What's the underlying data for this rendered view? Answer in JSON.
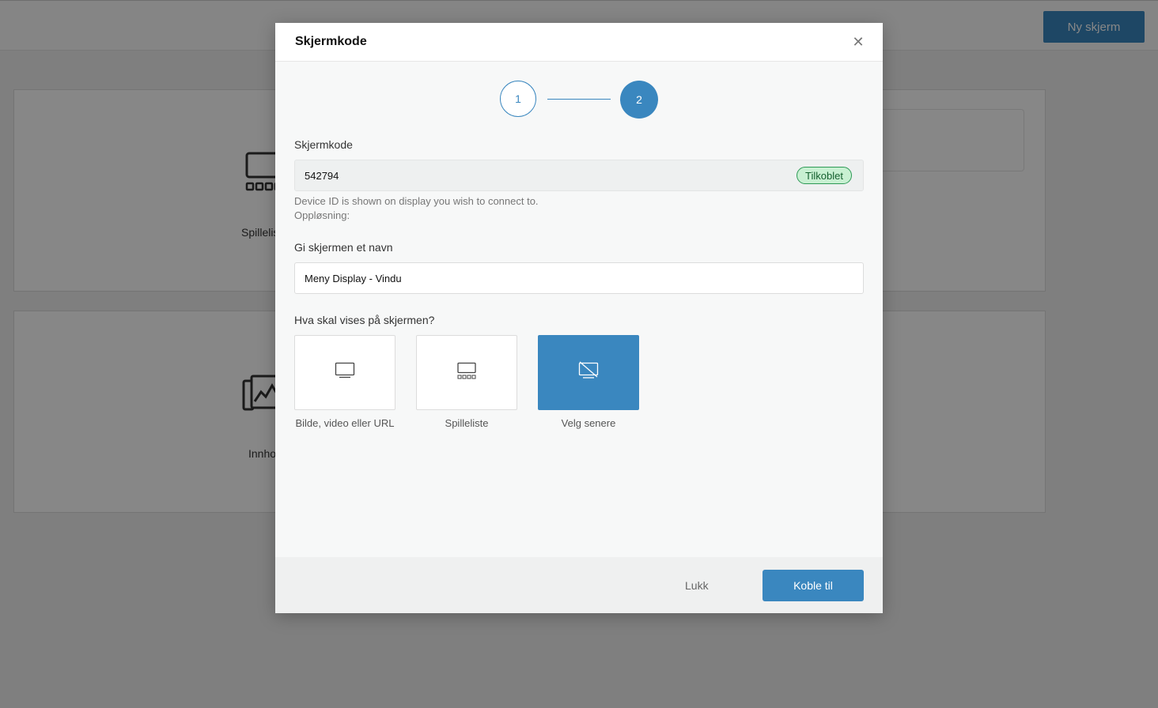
{
  "background": {
    "new_screen_button": "Ny skjerm",
    "cards": [
      {
        "label": "Spilleliste",
        "icon": "playlist-monitor-icon"
      },
      {
        "label": "Innhold",
        "icon": "media-gallery-icon"
      }
    ]
  },
  "modal": {
    "title": "Skjermkode",
    "close_icon": "close-icon",
    "steps": [
      "1",
      "2"
    ],
    "active_step": 2,
    "screen_code": {
      "label": "Skjermkode",
      "value": "542794",
      "status": "Tilkoblet",
      "help": "Device ID is shown on display you wish to connect to.",
      "resolution_label": "Oppløsning:"
    },
    "name_field": {
      "label": "Gi skjermen et navn",
      "value": "Meny Display - Vindu"
    },
    "content_question": "Hva skal vises på skjermen?",
    "options": [
      {
        "label": "Bilde, video eller URL",
        "icon": "monitor-icon",
        "selected": false
      },
      {
        "label": "Spilleliste",
        "icon": "playlist-monitor-icon",
        "selected": false
      },
      {
        "label": "Velg senere",
        "icon": "monitor-off-icon",
        "selected": true
      }
    ],
    "footer": {
      "close_label": "Lukk",
      "connect_label": "Koble til"
    }
  },
  "colors": {
    "accent": "#3a87bf",
    "status_bg": "#c8f0d2",
    "status_border": "#2e9a56"
  }
}
